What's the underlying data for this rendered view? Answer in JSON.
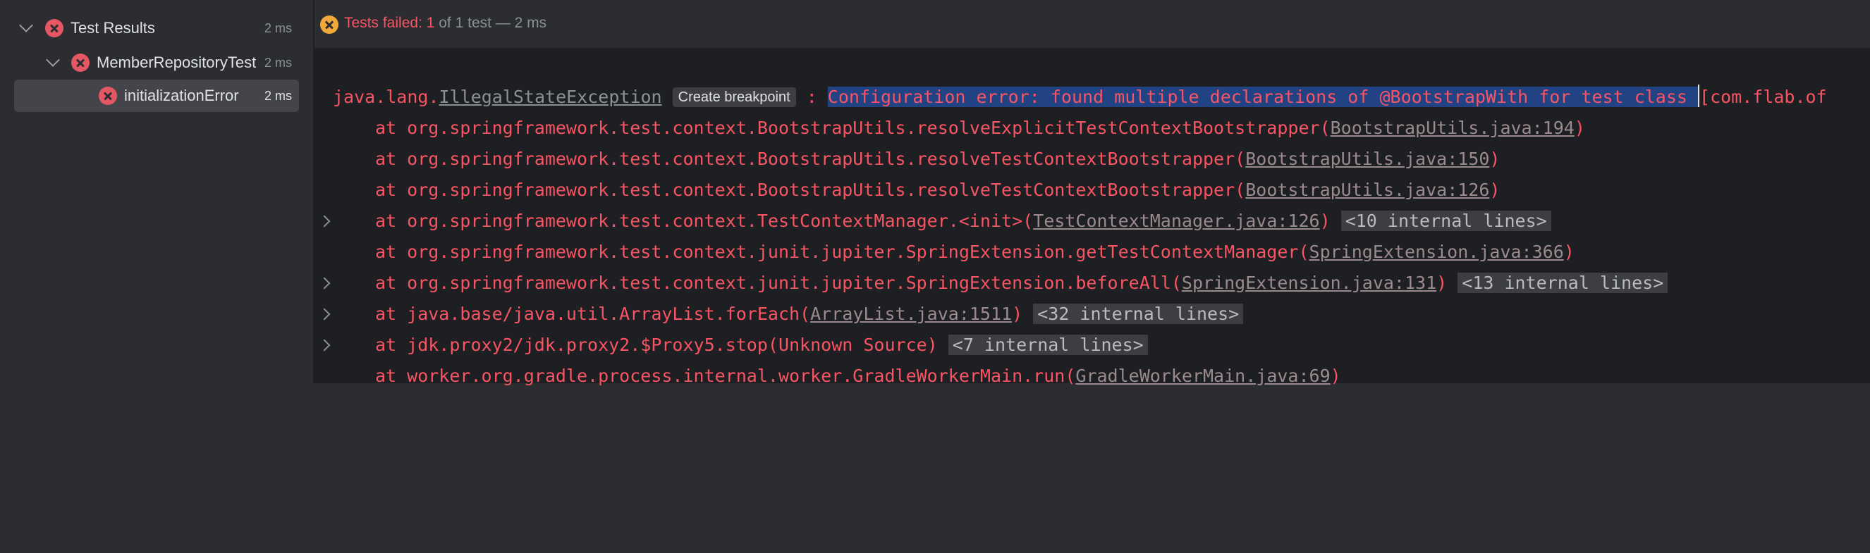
{
  "tree": {
    "root": {
      "label": "Test Results",
      "time": "2 ms"
    },
    "suite": {
      "label": "MemberRepositoryTest",
      "time": "2 ms"
    },
    "test": {
      "label": "initializationError",
      "time": "2 ms"
    }
  },
  "status": {
    "prefix": "Tests failed: ",
    "failed": "1",
    "of": " of ",
    "total": "1",
    "suffix": " test",
    "sep": " — ",
    "time": "2 ms"
  },
  "console": {
    "exc_prefix": "java.lang.",
    "exc_name": "IllegalStateException",
    "breakpoint": "Create breakpoint",
    "colon": " : ",
    "message": "Configuration error: found multiple declarations of @BootstrapWith for test class ",
    "message_tail": "[com.flab.of",
    "frames": [
      {
        "text": "at org.springframework.test.context.BootstrapUtils.resolveExplicitTestContextBootstrapper(",
        "link": "BootstrapUtils.java:194",
        "close": ")",
        "internal": ""
      },
      {
        "text": "at org.springframework.test.context.BootstrapUtils.resolveTestContextBootstrapper(",
        "link": "BootstrapUtils.java:150",
        "close": ")",
        "internal": ""
      },
      {
        "text": "at org.springframework.test.context.BootstrapUtils.resolveTestContextBootstrapper(",
        "link": "BootstrapUtils.java:126",
        "close": ")",
        "internal": ""
      },
      {
        "text": "at org.springframework.test.context.TestContextManager.<init>(",
        "link": "TestContextManager.java:126",
        "close": ")",
        "internal": "<10 internal lines>"
      },
      {
        "text": "at org.springframework.test.context.junit.jupiter.SpringExtension.getTestContextManager(",
        "link": "SpringExtension.java:366",
        "close": ")",
        "internal": ""
      },
      {
        "text": "at org.springframework.test.context.junit.jupiter.SpringExtension.beforeAll(",
        "link": "SpringExtension.java:131",
        "close": ")",
        "internal": "<13 internal lines>"
      },
      {
        "text": "at java.base/java.util.ArrayList.forEach(",
        "link": "ArrayList.java:1511",
        "close": ")",
        "internal": "<32 internal lines>"
      },
      {
        "text": "at jdk.proxy2/jdk.proxy2.$Proxy5.stop(Unknown Source)",
        "link": "",
        "close": "",
        "internal": "<7 internal lines>"
      },
      {
        "text": "at worker.org.gradle.process.internal.worker.GradleWorkerMain.run(",
        "link": "GradleWorkerMain.java:69",
        "close": ")",
        "internal": ""
      }
    ]
  },
  "colors": {
    "error": "#f75464",
    "warning": "#f2a93b",
    "selection": "#214283"
  }
}
